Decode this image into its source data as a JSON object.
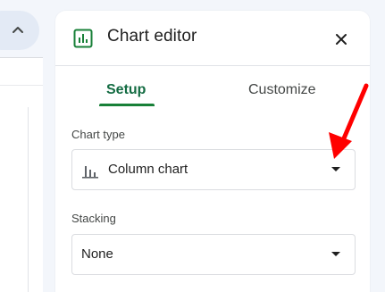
{
  "panel": {
    "title": "Chart editor"
  },
  "tabs": [
    {
      "label": "Setup",
      "active": true
    },
    {
      "label": "Customize",
      "active": false
    }
  ],
  "chart_type": {
    "label": "Chart type",
    "value": "Column chart",
    "icon": "column-chart-icon"
  },
  "stacking": {
    "label": "Stacking",
    "value": "None"
  },
  "icons": {
    "panel": "chart-icon",
    "close": "close-icon",
    "collapse": "chevron-up-icon"
  },
  "colors": {
    "accent": "#188038",
    "annotation": "#ff0000"
  }
}
